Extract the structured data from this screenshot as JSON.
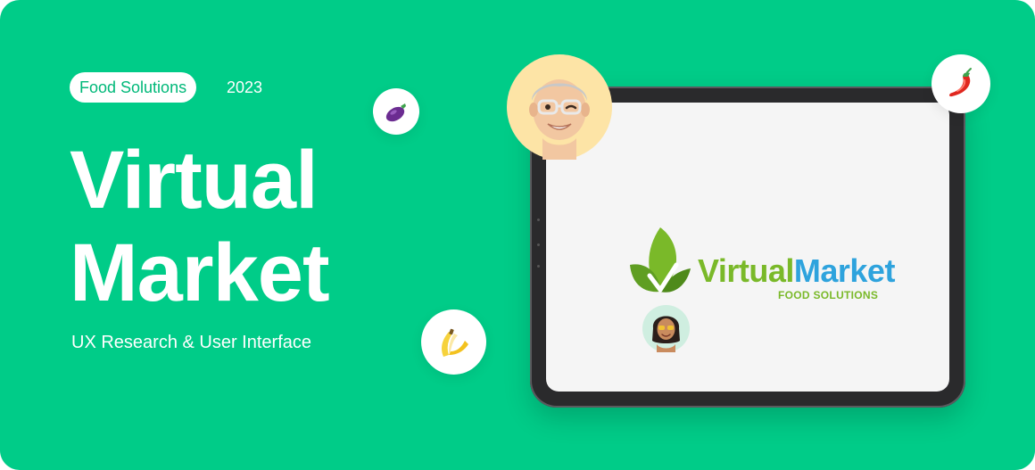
{
  "tag": {
    "label": "Food Solutions"
  },
  "year": "2023",
  "title": {
    "line1": "Virtual",
    "line2": "Market"
  },
  "subtitle": "UX Research & User Interface",
  "logo": {
    "part1": "Virtual",
    "part2": "Market",
    "tagline": "FOOD SOLUTIONS"
  },
  "icons": {
    "eggplant": "eggplant-icon",
    "banana": "banana-icon",
    "chili": "chili-pepper-icon",
    "avatar_man": "man-memoji-avatar",
    "avatar_woman": "woman-memoji-avatar"
  },
  "colors": {
    "background": "#00cc88",
    "logo_green": "#7ab929",
    "logo_blue": "#2ea3dd"
  }
}
